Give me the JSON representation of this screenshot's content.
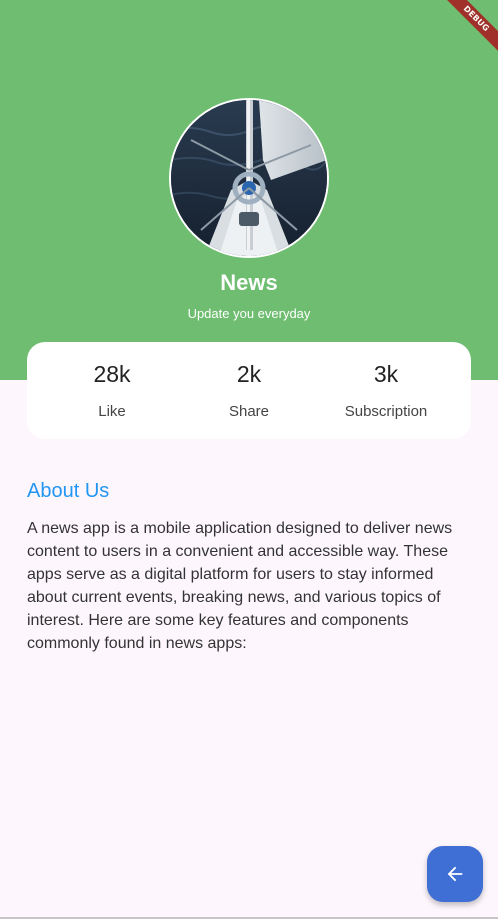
{
  "profile": {
    "name": "News",
    "tagline": "Update you everyday"
  },
  "stats": [
    {
      "value": "28k",
      "label": "Like"
    },
    {
      "value": "2k",
      "label": "Share"
    },
    {
      "value": "3k",
      "label": "Subscription"
    }
  ],
  "about": {
    "heading": "About Us",
    "body": "A news app is a mobile application designed to deliver news content to users in a convenient and accessible way. These apps serve as a digital platform for users to stay informed about current events, breaking news, and various topics of interest. Here are some key features and components commonly found in news apps:"
  },
  "debug_banner": {
    "label": "DEBUG"
  },
  "fab": {
    "icon": "arrow-back-icon"
  },
  "colors": {
    "header_bg": "#6ebd70",
    "accent": "#2196f3",
    "fab_bg": "#3f6ed4",
    "page_bg": "#fdf7fd",
    "debug_ribbon": "#a0312a"
  }
}
